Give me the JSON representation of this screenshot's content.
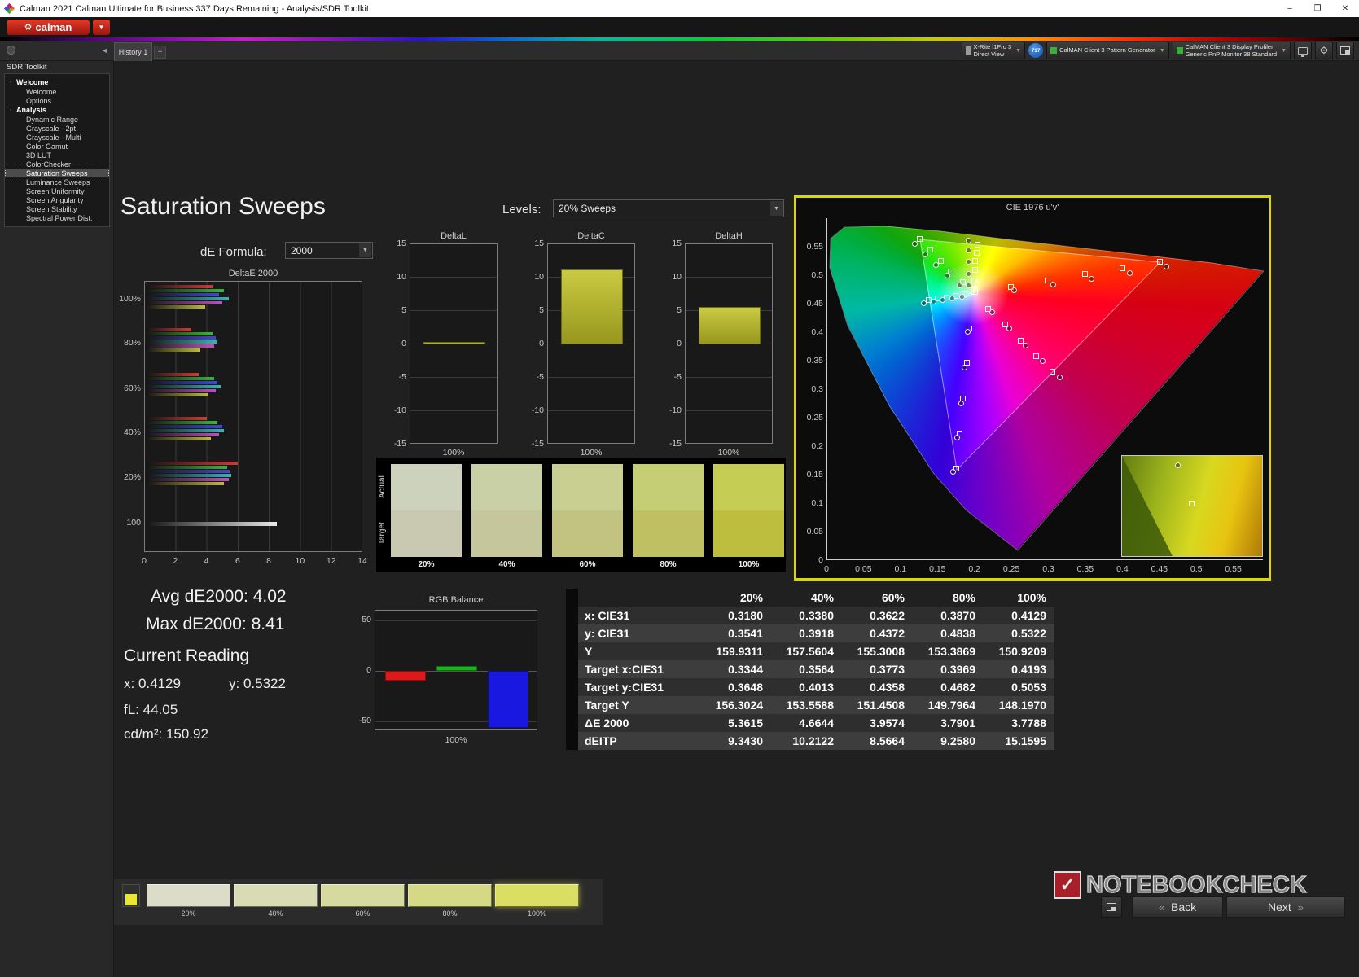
{
  "window": {
    "title": "Calman 2021 Calman Ultimate for Business 337 Days Remaining  - Analysis/SDR Toolkit",
    "minimize": "–",
    "maximize": "❐",
    "close": "✕"
  },
  "brand": {
    "logo_text": "calman",
    "brand_red": "#c01d1d",
    "panel_accent_yellow": "#d9d900"
  },
  "toolbar": {
    "history_tab": "History 1",
    "add_tab": "+",
    "meter_line1": "X-Rite i1Pro 3",
    "meter_line2": "Direct View",
    "badge": "717",
    "pattern_line1": "CalMAN Client 3 Pattern Generator",
    "profiler_line1": "CalMAN Client 3 Display Profiler",
    "profiler_line2": "Generic PnP Monitor 38 Standard"
  },
  "sidebar": {
    "title": "SDR Toolkit",
    "selected_item": "Saturation Sweeps",
    "tree": [
      {
        "section": "Welcome",
        "items": [
          "Welcome",
          "Options"
        ]
      },
      {
        "section": "Analysis",
        "items": [
          "Dynamic Range",
          "Grayscale - 2pt",
          "Grayscale - Multi",
          "Color Gamut",
          "3D LUT",
          "ColorChecker",
          "Saturation Sweeps",
          "Luminance Sweeps",
          "Screen Uniformity",
          "Screen Angularity",
          "Screen Stability",
          "Spectral Power Dist."
        ]
      }
    ]
  },
  "page": {
    "title": "Saturation Sweeps",
    "de_formula_label": "dE Formula:",
    "de_formula_value": "2000",
    "levels_label": "Levels:",
    "levels_value": "20% Sweeps"
  },
  "readings": {
    "avg": "Avg dE2000: 4.02",
    "max": "Max dE2000: 8.41",
    "current_label": "Current Reading",
    "x": "x: 0.4129",
    "y": "y: 0.5322",
    "fl": "fL: 44.05",
    "cd": "cd/m²: 150.92"
  },
  "swatches": {
    "row_labels": [
      "Actual",
      "Target"
    ],
    "columns": [
      "20%",
      "40%",
      "60%",
      "80%",
      "100%"
    ],
    "actual_colors": [
      "#ccd2bc",
      "#cad0a6",
      "#c8cf90",
      "#c6ce75",
      "#c5cd55"
    ],
    "target_colors": [
      "#c9c9b2",
      "#c5c69b",
      "#c2c380",
      "#bfc062",
      "#bdbe3e"
    ]
  },
  "bottom_strip": {
    "labels": [
      "20%",
      "40%",
      "60%",
      "80%",
      "100%"
    ],
    "colors": [
      "#dbddc9",
      "#d9dbb4",
      "#d7da9e",
      "#d5d985",
      "#dadf63"
    ],
    "selected": "100%"
  },
  "footer": {
    "back": "Back",
    "next": "Next",
    "back_chevrons": "«",
    "next_chevrons": "»",
    "watermark": "NOTEBOOKCHECK"
  },
  "chart_data": [
    {
      "type": "bar",
      "title": "DeltaE 2000",
      "orientation": "horizontal",
      "categories": [
        "100%",
        "80%",
        "60%",
        "40%",
        "20%",
        "100"
      ],
      "series_names": [
        "Red",
        "Green",
        "Blue",
        "Cyan",
        "Magenta",
        "Yellow"
      ],
      "series_colors": [
        "#cf3a3a",
        "#3cb43c",
        "#4646d2",
        "#3ab4b4",
        "#c050c0",
        "#bcbc3c"
      ],
      "groups": [
        [
          4.3,
          5.0,
          4.7,
          5.3,
          4.9,
          3.8
        ],
        [
          2.9,
          4.3,
          4.5,
          4.6,
          4.4,
          3.5
        ],
        [
          3.4,
          4.4,
          4.6,
          4.8,
          4.5,
          4.0
        ],
        [
          3.9,
          4.6,
          4.9,
          5.0,
          4.7,
          4.2
        ],
        [
          5.9,
          5.2,
          5.4,
          5.5,
          5.3,
          5.0
        ],
        [
          8.41
        ]
      ],
      "last_group_color": "#e8e8e8",
      "xlim": [
        0,
        14
      ],
      "xticks": [
        0,
        2,
        4,
        6,
        8,
        10,
        12,
        14
      ]
    },
    {
      "type": "bar",
      "title": "DeltaL",
      "categories": [
        "100%"
      ],
      "values": [
        0.4
      ],
      "ylim": [
        -15,
        15
      ],
      "yticks": [
        15,
        10,
        5,
        0,
        -5,
        -10,
        -15
      ],
      "bar_color": "#b9ba2b"
    },
    {
      "type": "bar",
      "title": "DeltaC",
      "categories": [
        "100%"
      ],
      "values": [
        11.2
      ],
      "ylim": [
        -15,
        15
      ],
      "yticks": [
        15,
        10,
        5,
        0,
        -5,
        -10,
        -15
      ],
      "bar_color": "#b9ba2b"
    },
    {
      "type": "bar",
      "title": "DeltaH",
      "categories": [
        "100%"
      ],
      "values": [
        5.6
      ],
      "ylim": [
        -15,
        15
      ],
      "yticks": [
        15,
        10,
        5,
        0,
        -5,
        -10,
        -15
      ],
      "bar_color": "#b9ba2b"
    },
    {
      "type": "bar",
      "title": "RGB Balance",
      "categories": [
        "Red",
        "Green",
        "Blue"
      ],
      "values": [
        -10,
        5,
        -57
      ],
      "colors": [
        "#e01818",
        "#18b418",
        "#1818e0"
      ],
      "ylim": [
        -60,
        60
      ],
      "yticks": [
        50,
        0,
        -50
      ],
      "x_label": "100%"
    },
    {
      "type": "scatter",
      "title": "CIE 1976 u'v'",
      "x_ticks": [
        "0",
        "0.05",
        "0.1",
        "0.15",
        "0.2",
        "0.25",
        "0.3",
        "0.35",
        "0.4",
        "0.45",
        "0.5",
        "0.55"
      ],
      "y_ticks": [
        "0",
        "0.05",
        "0.1",
        "0.15",
        "0.2",
        "0.25",
        "0.3",
        "0.35",
        "0.4",
        "0.45",
        "0.5",
        "0.55"
      ],
      "white_point": [
        33.8,
        21.4
      ],
      "targets": [
        [
          33.8,
          18.3
        ],
        [
          34.0,
          15.2
        ],
        [
          34.1,
          12.6
        ],
        [
          34.3,
          10.2
        ],
        [
          34.5,
          7.9
        ],
        [
          42.2,
          20.2
        ],
        [
          50.7,
          18.3
        ],
        [
          59.3,
          16.4
        ],
        [
          67.9,
          14.8
        ],
        [
          76.5,
          12.9
        ],
        [
          31.2,
          18.8
        ],
        [
          28.5,
          15.7
        ],
        [
          26.1,
          12.6
        ],
        [
          23.7,
          9.3
        ],
        [
          21.3,
          6.2
        ],
        [
          32.8,
          32.4
        ],
        [
          32.1,
          42.6
        ],
        [
          31.3,
          53.1
        ],
        [
          30.4,
          63.3
        ],
        [
          29.7,
          73.6
        ],
        [
          31.5,
          22.4
        ],
        [
          29.5,
          22.9
        ],
        [
          27.4,
          23.3
        ],
        [
          25.4,
          23.6
        ],
        [
          23.3,
          24.0
        ],
        [
          37.1,
          26.7
        ],
        [
          40.9,
          31.2
        ],
        [
          44.4,
          36.0
        ],
        [
          48.1,
          40.5
        ],
        [
          51.7,
          45.0
        ]
      ],
      "measured": [
        [
          32.6,
          19.8
        ],
        [
          32.6,
          16.4
        ],
        [
          32.6,
          12.9
        ],
        [
          32.6,
          9.5
        ],
        [
          32.6,
          6.7
        ],
        [
          42.9,
          21.2
        ],
        [
          51.9,
          19.5
        ],
        [
          60.8,
          17.9
        ],
        [
          69.6,
          16.2
        ],
        [
          78.0,
          14.3
        ],
        [
          30.4,
          19.8
        ],
        [
          27.6,
          16.9
        ],
        [
          25.0,
          13.8
        ],
        [
          22.6,
          10.7
        ],
        [
          20.1,
          7.6
        ],
        [
          32.3,
          33.3
        ],
        [
          31.5,
          43.8
        ],
        [
          30.8,
          54.3
        ],
        [
          29.9,
          64.5
        ],
        [
          28.9,
          74.5
        ],
        [
          31.0,
          23.1
        ],
        [
          28.7,
          23.6
        ],
        [
          26.5,
          24.0
        ],
        [
          24.4,
          24.5
        ],
        [
          22.2,
          25.0
        ],
        [
          37.9,
          27.6
        ],
        [
          41.8,
          32.4
        ],
        [
          45.7,
          37.4
        ],
        [
          49.6,
          42.1
        ],
        [
          53.4,
          46.7
        ]
      ],
      "inset": {
        "square": [
          50,
          48
        ],
        "circle": [
          40,
          10
        ]
      }
    },
    {
      "type": "table",
      "columns": [
        "",
        "20%",
        "40%",
        "60%",
        "80%",
        "100%"
      ],
      "rows": [
        [
          "x: CIE31",
          "0.3180",
          "0.3380",
          "0.3622",
          "0.3870",
          "0.4129"
        ],
        [
          "y: CIE31",
          "0.3541",
          "0.3918",
          "0.4372",
          "0.4838",
          "0.5322"
        ],
        [
          "Y",
          "159.9311",
          "157.5604",
          "155.3008",
          "153.3869",
          "150.9209"
        ],
        [
          "Target x:CIE31",
          "0.3344",
          "0.3564",
          "0.3773",
          "0.3969",
          "0.4193"
        ],
        [
          "Target y:CIE31",
          "0.3648",
          "0.4013",
          "0.4358",
          "0.4682",
          "0.5053"
        ],
        [
          "Target Y",
          "156.3024",
          "153.5588",
          "151.4508",
          "149.7964",
          "148.1970"
        ],
        [
          "ΔE 2000",
          "5.3615",
          "4.6644",
          "3.9574",
          "3.7901",
          "3.7788"
        ],
        [
          "dEITP",
          "9.3430",
          "10.2122",
          "8.5664",
          "9.2580",
          "15.1595"
        ]
      ]
    }
  ]
}
